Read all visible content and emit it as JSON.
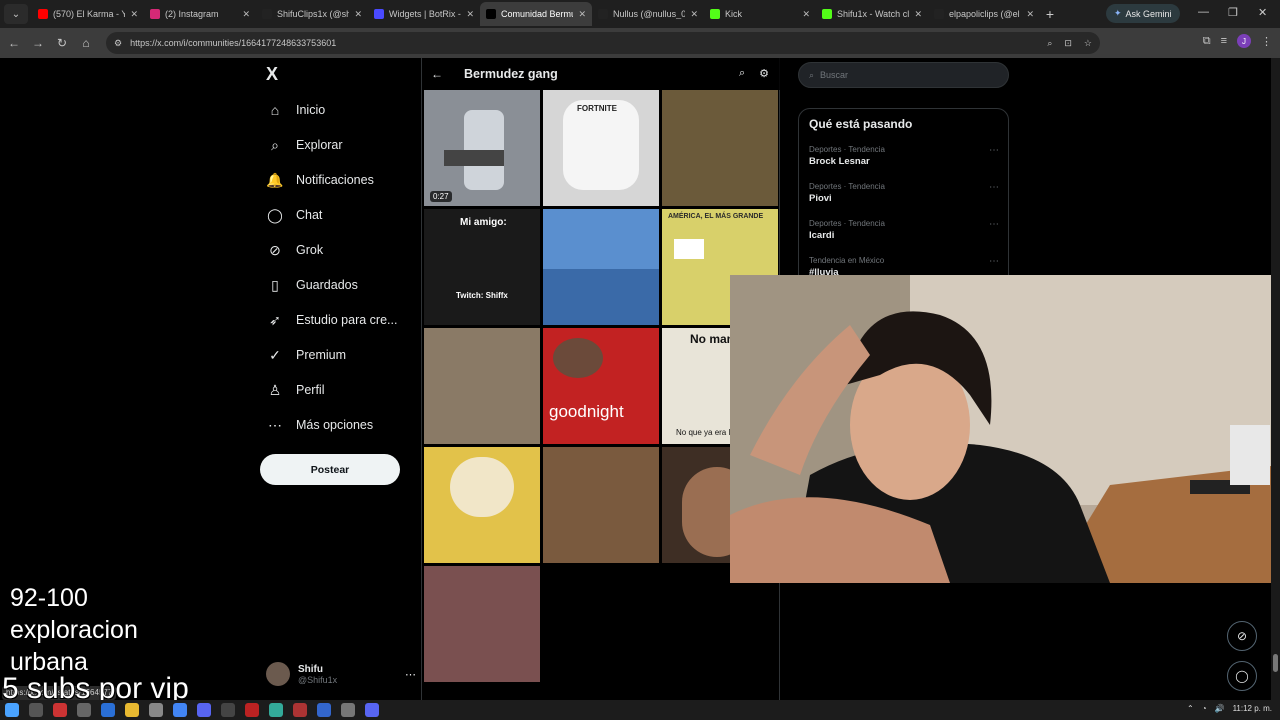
{
  "browser": {
    "tabs": [
      {
        "title": "(570) El Karma - Y",
        "favicon": "youtube-icon",
        "color": "#ff0000"
      },
      {
        "title": "(2) Instagram",
        "favicon": "instagram-icon",
        "color": "#d62976"
      },
      {
        "title": "ShifuClips1x (@sh",
        "favicon": "tiktok-icon",
        "color": "#222222"
      },
      {
        "title": "Widgets | BotRix -",
        "favicon": "botrix-icon",
        "color": "#4a4aff"
      },
      {
        "title": "Comunidad Bermu",
        "favicon": "x-icon",
        "color": "#000000"
      },
      {
        "title": "Nullus (@nullus_0",
        "favicon": "tiktok-icon",
        "color": "#222222"
      },
      {
        "title": "Kick",
        "favicon": "kick-icon",
        "color": "#53fc18"
      },
      {
        "title": "Shifu1x - Watch cl",
        "favicon": "kick-icon",
        "color": "#53fc18"
      },
      {
        "title": "elpapoliclips (@el",
        "favicon": "tiktok-icon",
        "color": "#222222"
      }
    ],
    "active_tab_index": 4,
    "gemini_label": "Ask Gemini",
    "url": "https://x.com/i/communities/1664177248633753601",
    "profile_letter": "J"
  },
  "nav": {
    "logo": "X",
    "items": [
      {
        "label": "Inicio",
        "icon": "home-icon",
        "glyph": "⌂"
      },
      {
        "label": "Explorar",
        "icon": "search-icon",
        "glyph": "⌕"
      },
      {
        "label": "Notificaciones",
        "icon": "bell-icon",
        "glyph": "🔔"
      },
      {
        "label": "Chat",
        "icon": "chat-icon",
        "glyph": "◯"
      },
      {
        "label": "Grok",
        "icon": "grok-icon",
        "glyph": "⊘"
      },
      {
        "label": "Guardados",
        "icon": "bookmark-icon",
        "glyph": "▯"
      },
      {
        "label": "Estudio para cre...",
        "icon": "rocket-icon",
        "glyph": "➶"
      },
      {
        "label": "Premium",
        "icon": "premium-icon",
        "glyph": "✓"
      },
      {
        "label": "Perfil",
        "icon": "profile-icon",
        "glyph": "♙"
      },
      {
        "label": "Más opciones",
        "icon": "more-icon",
        "glyph": "⋯"
      }
    ],
    "post_label": "Postear",
    "user": {
      "name": "Shifu",
      "handle": "@Shifu1x"
    }
  },
  "community": {
    "title": "Bermudez gang",
    "media": [
      {
        "duration": "0:27",
        "caption": "",
        "bg": "#8a8f96"
      },
      {
        "duration": "",
        "caption": "FORTNITE",
        "bg": "#d6d6d6"
      },
      {
        "duration": "",
        "caption": "",
        "bg": "#6b5a3a"
      },
      {
        "duration": "",
        "caption": "Mi amigo:",
        "caption2": "Twitch: Shiffx",
        "bg": "#1a1a1a"
      },
      {
        "duration": "",
        "caption": "",
        "bg": "#5a8fcf"
      },
      {
        "duration": "",
        "caption": "AMÉRICA, EL MÁS GRANDE",
        "bg": "#d8d06a"
      },
      {
        "duration": "",
        "caption": "",
        "bg": "#8a7a66"
      },
      {
        "duration": "",
        "caption": "goodnight",
        "bg": "#c22222"
      },
      {
        "duration": "",
        "caption": "No man",
        "caption2": "No que ya era le",
        "bg": "#e8e4d8"
      },
      {
        "duration": "",
        "caption": "",
        "bg": "#e2c24a"
      },
      {
        "duration": "",
        "caption": "",
        "bg": "#7a5a3e"
      },
      {
        "duration": "",
        "caption": "",
        "bg": "#3e2e24"
      },
      {
        "duration": "",
        "caption": "",
        "bg": "#7a5050"
      }
    ]
  },
  "sidebar": {
    "search_placeholder": "Buscar",
    "trends_title": "Qué está pasando",
    "trends": [
      {
        "meta": "Deportes · Tendencia",
        "name": "Brock Lesnar"
      },
      {
        "meta": "Deportes · Tendencia",
        "name": "Piovi"
      },
      {
        "meta": "Deportes · Tendencia",
        "name": "Icardi"
      },
      {
        "meta": "Tendencia en México",
        "name": "#lluvia"
      }
    ]
  },
  "overlay": {
    "line1": "92-100",
    "line2": "exploracion",
    "line3": "urbana",
    "line4": "5 subs por vip"
  },
  "status_link": "https://x.com/i/status/1664577",
  "taskbar": {
    "time": "11:12 p. m."
  }
}
